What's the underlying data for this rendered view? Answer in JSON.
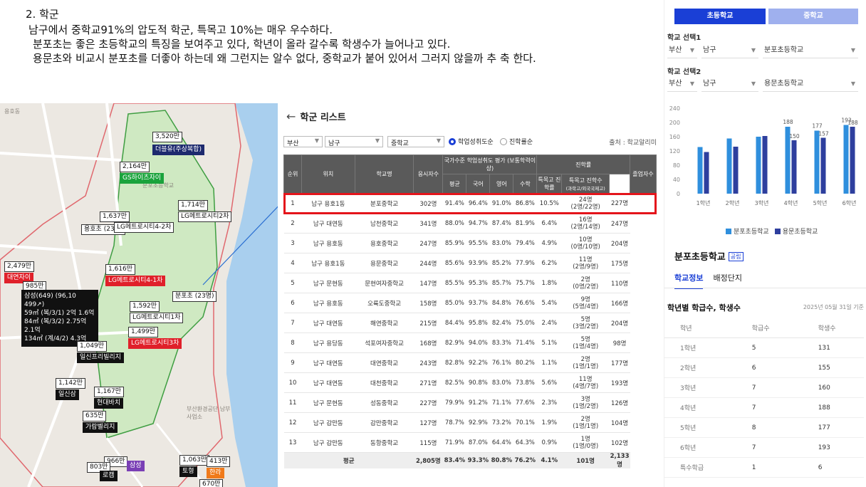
{
  "intro": {
    "title": "2. 학군",
    "lines": [
      "남구에서 중학교91%의 압도적 학군, 특목고 10%는 매우 우수하다.",
      "분포초는 좋은 초등학교의 특징을 보여주고 있다, 학년이 올라 갈수록 학생수가 늘어나고 있다.",
      "용문초와 비교시 분포초를 더좋아 하는데 왜 그런지는 알수 없다, 중학교가 붙어 있어서 그러지 않을까 추 축 한다."
    ]
  },
  "map": {
    "labels": [
      "3,520만",
      "더블유(주상복합)",
      "2,164만",
      "GS하이츠자이",
      "1,714만",
      "LG메트로시티2차",
      "1,637만",
      "용호초 (23명)",
      "LG메트로시티4-2차",
      "2,479만",
      "대연자이",
      "1,616만",
      "LG메트로시티4-1차",
      "985만",
      "분포초 (23명)",
      "1,592만",
      "LG메트로시티1차",
      "1,499만",
      "LG메트로시티3차",
      "1,049만",
      "일신프리빌리지",
      "1,142만",
      "일신삼",
      "1,167만",
      "현대바치",
      "635만",
      "가람벨리지",
      "966만",
      "1,063만",
      "413만",
      "삼성",
      "803만",
      "로캠",
      "토형",
      "한라",
      "670만"
    ],
    "infobox": [
      "삼성(649) (96,10 499↗)",
      "59㎡ (복/3/1)   2억   1.6억",
      "84㎡ (복/3/2)  2.75억  2.1억",
      "134㎡ (계/4/2)   4.3억"
    ],
    "places": [
      "용호동",
      "대연자이",
      "분포초등학교",
      "부산환경공단 남부사업소"
    ]
  },
  "panel": {
    "title": "학군 리스트",
    "back_icon": "arrow-left-icon",
    "filters": {
      "city": "부산",
      "district": "남구",
      "level": "중학교"
    },
    "radio": [
      {
        "label": "학업성취도순",
        "checked": true
      },
      {
        "label": "진학률순",
        "checked": false
      }
    ],
    "source": "출처 : 학교알리미",
    "headers": {
      "rank": "순위",
      "location": "위치",
      "school": "학교명",
      "students": "응시자수",
      "group_national": "국가수준 학업성취도 평가 (보통학력이상)",
      "avg": "평균",
      "korean": "국어",
      "english": "영어",
      "math": "수학",
      "group_adv": "진학률",
      "special_rate": "특목고 진학률",
      "special_count": "특목고 진학수",
      "special_count_sub": "(과학고/외국국제고)",
      "grads": "졸업자수"
    },
    "rows": [
      [
        "1",
        "남구 용호1동",
        "분포중학교",
        "302명",
        "91.4%",
        "96.4%",
        "91.0%",
        "86.8%",
        "10.5%",
        "24명",
        "(2명/22명)",
        "227명"
      ],
      [
        "2",
        "남구 대연동",
        "남천중학교",
        "341명",
        "88.0%",
        "94.7%",
        "87.4%",
        "81.9%",
        "6.4%",
        "16명",
        "(2명/14명)",
        "247명"
      ],
      [
        "3",
        "남구 용호동",
        "용호중학교",
        "247명",
        "85.9%",
        "95.5%",
        "83.0%",
        "79.4%",
        "4.9%",
        "10명",
        "(0명/10명)",
        "204명"
      ],
      [
        "4",
        "남구 용호1동",
        "용문중학교",
        "244명",
        "85.6%",
        "93.9%",
        "85.2%",
        "77.9%",
        "6.2%",
        "11명",
        "(2명/9명)",
        "175명"
      ],
      [
        "5",
        "남구 문현동",
        "문현여자중학교",
        "147명",
        "85.5%",
        "95.3%",
        "85.7%",
        "75.7%",
        "1.8%",
        "2명",
        "(0명/2명)",
        "110명"
      ],
      [
        "6",
        "남구 용호동",
        "오륙도중학교",
        "158명",
        "85.0%",
        "93.7%",
        "84.8%",
        "76.6%",
        "5.4%",
        "9명",
        "(5명/4명)",
        "166명"
      ],
      [
        "7",
        "남구 대연동",
        "해연중학교",
        "215명",
        "84.4%",
        "95.8%",
        "82.4%",
        "75.0%",
        "2.4%",
        "5명",
        "(3명/2명)",
        "204명"
      ],
      [
        "8",
        "남구 용당동",
        "석포여자중학교",
        "168명",
        "82.9%",
        "94.0%",
        "83.3%",
        "71.4%",
        "5.1%",
        "5명",
        "(1명/4명)",
        "98명"
      ],
      [
        "9",
        "남구 대연동",
        "대연중학교",
        "243명",
        "82.8%",
        "92.2%",
        "76.1%",
        "80.2%",
        "1.1%",
        "2명",
        "(1명/1명)",
        "177명"
      ],
      [
        "10",
        "남구 대연동",
        "대천중학교",
        "271명",
        "82.5%",
        "90.8%",
        "83.0%",
        "73.8%",
        "5.6%",
        "11명",
        "(4명/7명)",
        "193명"
      ],
      [
        "11",
        "남구 문현동",
        "성동중학교",
        "227명",
        "79.9%",
        "91.2%",
        "71.1%",
        "77.6%",
        "2.3%",
        "3명",
        "(1명/2명)",
        "126명"
      ],
      [
        "12",
        "남구 감만동",
        "감만중학교",
        "127명",
        "78.7%",
        "92.9%",
        "73.2%",
        "70.1%",
        "1.9%",
        "2명",
        "(1명/1명)",
        "104명"
      ],
      [
        "13",
        "남구 감만동",
        "동항중학교",
        "115명",
        "71.9%",
        "87.0%",
        "64.4%",
        "64.3%",
        "0.9%",
        "1명",
        "(1명/0명)",
        "102명"
      ]
    ],
    "avg_row": [
      "평균",
      "2,805명",
      "83.4%",
      "93.3%",
      "80.8%",
      "76.2%",
      "4.1%",
      "101명",
      "2,133명"
    ]
  },
  "right": {
    "tab_elem": "초등학교",
    "tab_middle": "중학교",
    "select1_label": "학교 선택1",
    "select1": {
      "city": "부산",
      "district": "남구",
      "school": "분포초등학교"
    },
    "select2_label": "학교 선택2",
    "select2": {
      "city": "부산",
      "district": "남구",
      "school": "용문초등학교"
    },
    "legend": [
      "분포초등학교",
      "용문초등학교"
    ],
    "school_name": "분포초등학교",
    "badge": "공립",
    "subtabs": [
      "학교정보",
      "배정단지"
    ],
    "grade_title": "학년별 학급수, 학생수",
    "grade_date": "2025년 05월 31일 기준",
    "grade_headers": [
      "학년",
      "학급수",
      "학생수"
    ],
    "grade_rows": [
      [
        "1학년",
        "5",
        "131"
      ],
      [
        "2학년",
        "6",
        "155"
      ],
      [
        "3학년",
        "7",
        "160"
      ],
      [
        "4학년",
        "7",
        "188"
      ],
      [
        "5학년",
        "8",
        "177"
      ],
      [
        "6학년",
        "7",
        "193"
      ],
      [
        "특수학급",
        "1",
        "6"
      ]
    ],
    "colors": {
      "primary": "#1a3fd6",
      "series1": "#2f8fdd",
      "series2": "#2e3f9e"
    }
  },
  "chart_data": {
    "type": "bar",
    "categories": [
      "1학년",
      "2학년",
      "3학년",
      "4학년",
      "5학년",
      "6학년"
    ],
    "series": [
      {
        "name": "분포초등학교",
        "values": [
          131,
          155,
          160,
          188,
          177,
          193
        ]
      },
      {
        "name": "용문초등학교",
        "values": [
          117,
          132,
          162,
          150,
          157,
          188
        ]
      }
    ],
    "data_labels": [
      {
        "category": "4학년",
        "series": 0,
        "text": "188"
      },
      {
        "category": "4학년",
        "series": 1,
        "text": "150"
      },
      {
        "category": "5학년",
        "series": 0,
        "text": "177"
      },
      {
        "category": "5학년",
        "series": 1,
        "text": "157"
      },
      {
        "category": "6학년",
        "series": 0,
        "text": "193"
      },
      {
        "category": "6학년",
        "series": 1,
        "text": "188"
      }
    ],
    "yticks": [
      "0",
      "40",
      "80",
      "120",
      "160",
      "200",
      "240"
    ],
    "ylim": [
      0,
      240
    ],
    "legend_position": "bottom",
    "grid": false
  }
}
